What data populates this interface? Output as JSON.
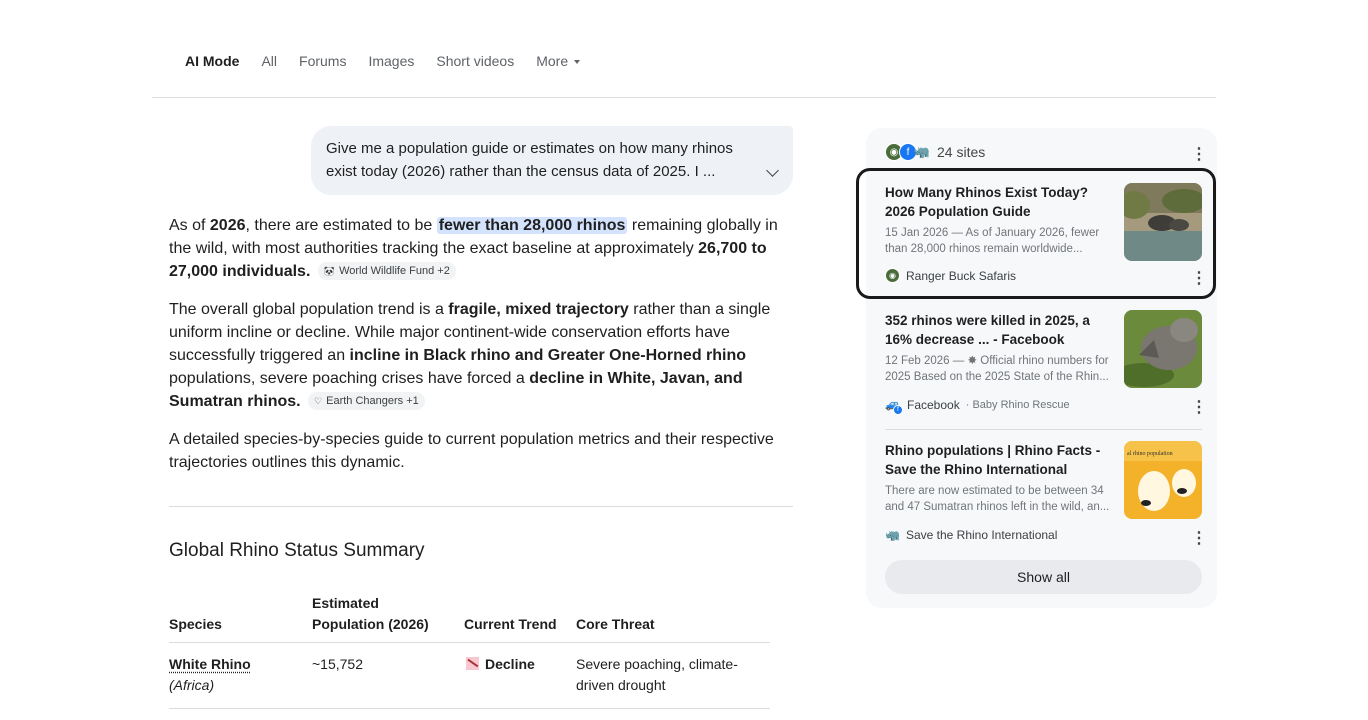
{
  "tabs": [
    "AI Mode",
    "All",
    "Forums",
    "Images",
    "Short videos",
    "More"
  ],
  "query": "Give me a population guide or estimates on how many rhinos exist today (2026) rather than the census data of 2025. I ...",
  "answer": {
    "p1": {
      "a": "As of ",
      "b": "2026",
      "c": ", there are estimated to be ",
      "hl": "fewer than 28,000 rhinos",
      "d": " remaining globally in the wild, with most authorities tracking the exact baseline at approximately ",
      "e": "26,700 to 27,000 individuals",
      "f": ".",
      "chip": "World Wildlife Fund +2"
    },
    "p2": {
      "a": "The overall global population trend is a ",
      "b": "fragile, mixed trajectory",
      "c": " rather than a single uniform incline or decline. While major continent-wide conservation efforts have successfully triggered an ",
      "d": "incline in Black rhino and Greater One-Horned rhino",
      "e": " populations, severe poaching crises have forced a ",
      "f": "decline in White, Javan, and Sumatran rhinos.",
      "chip": "Earth Changers +1"
    },
    "p3": "A detailed species-by-species guide to current population metrics and their respective trajectories outlines this dynamic."
  },
  "section_title": "Global Rhino Status Summary",
  "table": {
    "headers": [
      "Species",
      "Estimated Population (2026)",
      "Current Trend",
      "Core Threat"
    ],
    "rows": [
      {
        "species": "White Rhino",
        "region": "(Africa)",
        "pop": "~15,752",
        "trend": "Decline",
        "threat": "Severe poaching, climate-driven drought"
      }
    ]
  },
  "sources": {
    "count_label": "24 sites",
    "cards": [
      {
        "title": "How Many Rhinos Exist Today? 2026 Population Guide",
        "snippet": "15 Jan 2026 — As of January 2026, fewer than 28,000 rhinos remain worldwide...",
        "source": "Ranger Buck Safaris",
        "sub": ""
      },
      {
        "title": "352 rhinos were killed in 2025, a 16% decrease ... - Facebook",
        "snippet": "12 Feb 2026 — ✸ Official rhino numbers for 2025 Based on the 2025 State of the Rhin...",
        "source": "Facebook",
        "sub": "Baby Rhino Rescue"
      },
      {
        "title": "Rhino populations | Rhino Facts - Save the Rhino International",
        "snippet": "There are now estimated to be between 34 and 47 Sumatran rhinos left in the wild, an...",
        "source": "Save the Rhino International",
        "sub": ""
      }
    ],
    "show_all": "Show all"
  },
  "colors": {
    "highlight": "#d3e3fd",
    "panel_bg": "#f7f8fa",
    "chip_bg": "#f1f3f4"
  }
}
